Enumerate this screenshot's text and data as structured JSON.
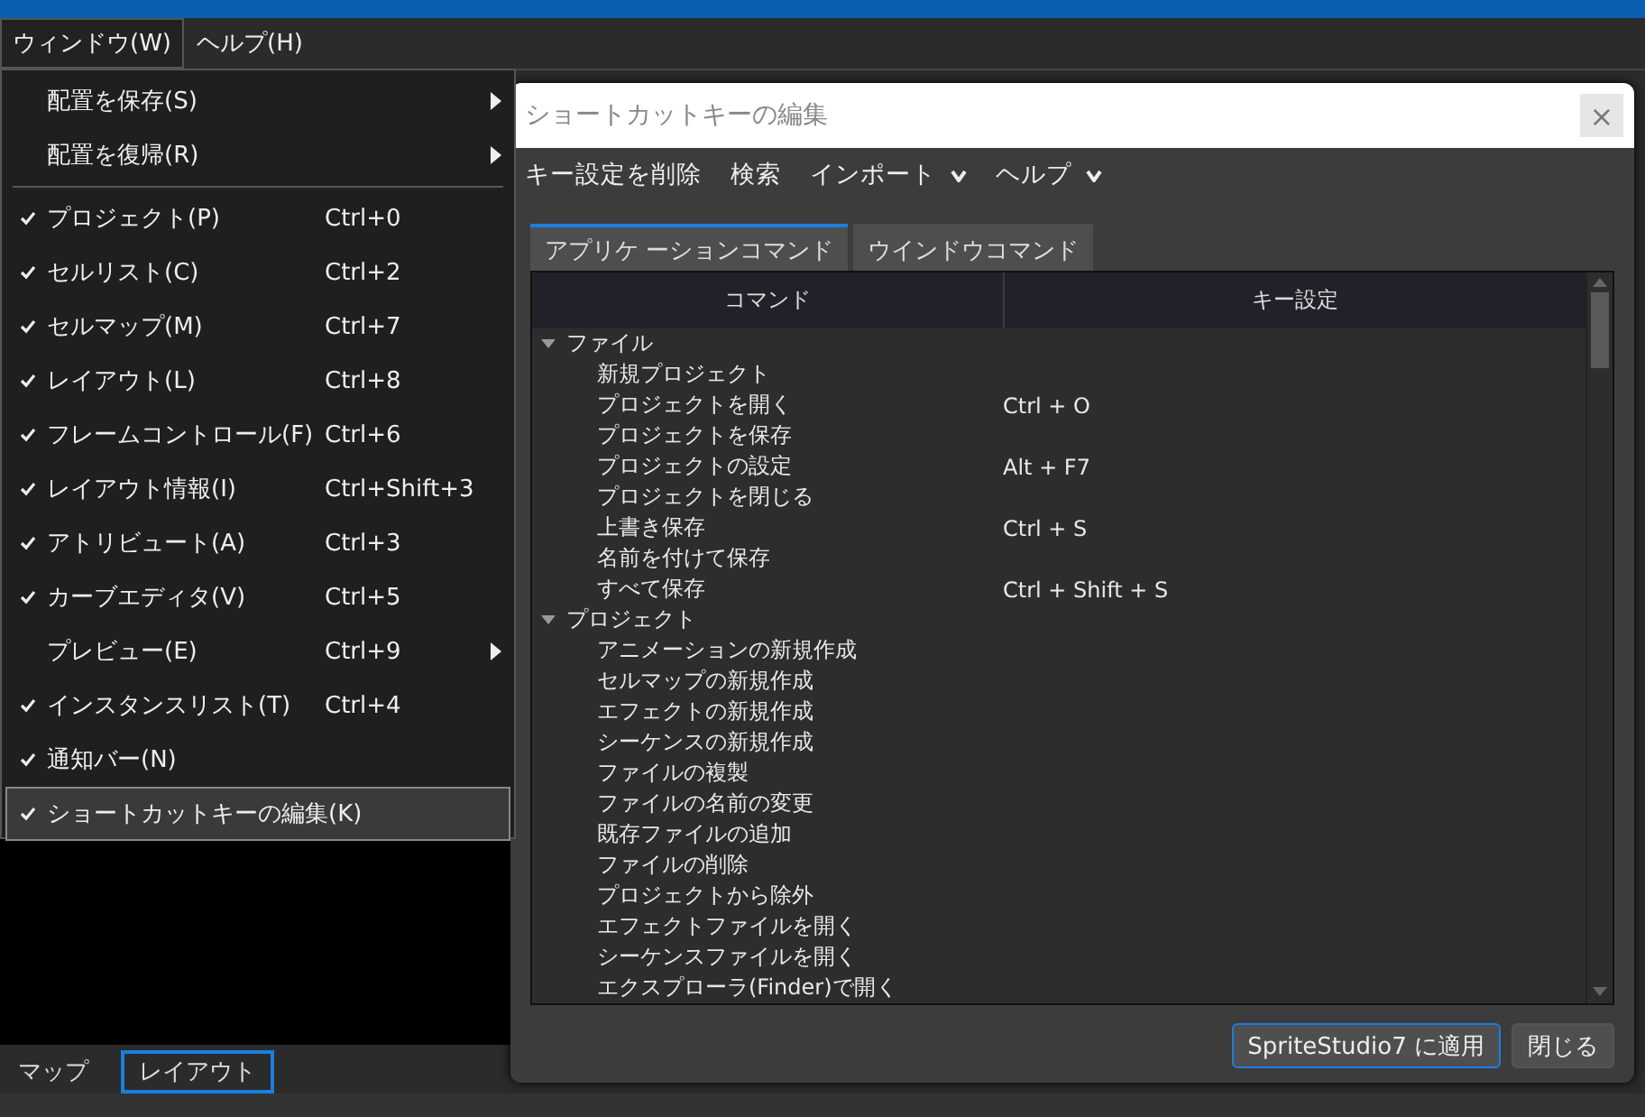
{
  "menubar": [
    {
      "label": "ウィンドウ(W)",
      "selected": true
    },
    {
      "label": "ヘルプ(H)",
      "selected": false
    }
  ],
  "dropdown": [
    {
      "kind": "item",
      "label": "配置を保存(S)",
      "checked": false,
      "submenu": true,
      "selected": false
    },
    {
      "kind": "item",
      "label": "配置を復帰(R)",
      "checked": false,
      "submenu": true,
      "selected": false
    },
    {
      "kind": "separator"
    },
    {
      "kind": "item",
      "label": "プロジェクト(P)",
      "shortcut": "Ctrl+0",
      "checked": true,
      "submenu": false,
      "selected": false
    },
    {
      "kind": "item",
      "label": "セルリスト(C)",
      "shortcut": "Ctrl+2",
      "checked": true,
      "submenu": false,
      "selected": false
    },
    {
      "kind": "item",
      "label": "セルマップ(M)",
      "shortcut": "Ctrl+7",
      "checked": true,
      "submenu": false,
      "selected": false
    },
    {
      "kind": "item",
      "label": "レイアウト(L)",
      "shortcut": "Ctrl+8",
      "checked": true,
      "submenu": false,
      "selected": false
    },
    {
      "kind": "item",
      "label": "フレームコントロール(F)",
      "shortcut": "Ctrl+6",
      "checked": true,
      "submenu": false,
      "selected": false
    },
    {
      "kind": "item",
      "label": "レイアウト情報(I)",
      "shortcut": "Ctrl+Shift+3",
      "checked": true,
      "submenu": false,
      "selected": false
    },
    {
      "kind": "item",
      "label": "アトリビュート(A)",
      "shortcut": "Ctrl+3",
      "checked": true,
      "submenu": false,
      "selected": false
    },
    {
      "kind": "item",
      "label": "カーブエディタ(V)",
      "shortcut": "Ctrl+5",
      "checked": true,
      "submenu": false,
      "selected": false
    },
    {
      "kind": "item",
      "label": "プレビュー(E)",
      "shortcut": "Ctrl+9",
      "checked": false,
      "submenu": true,
      "selected": false
    },
    {
      "kind": "item",
      "label": "インスタンスリスト(T)",
      "shortcut": "Ctrl+4",
      "checked": true,
      "submenu": false,
      "selected": false
    },
    {
      "kind": "item",
      "label": "通知バー(N)",
      "checked": true,
      "submenu": false,
      "selected": false
    },
    {
      "kind": "item",
      "label": "ショートカットキーの編集(K)",
      "checked": true,
      "submenu": false,
      "selected": true
    }
  ],
  "bottom_tabs": [
    {
      "label": "マップ",
      "selected": false
    },
    {
      "label": "レイアウト",
      "selected": true
    }
  ],
  "dialog": {
    "title": "ショートカットキーの編集",
    "close": "×",
    "toolbar": [
      {
        "label": "キー設定を削除",
        "dropdown": false
      },
      {
        "label": "検索",
        "dropdown": false
      },
      {
        "label": "インポート",
        "dropdown": true
      },
      {
        "label": "ヘルプ",
        "dropdown": true
      }
    ],
    "tabs": [
      {
        "label": "アプリケ ーションコマンド",
        "selected": true
      },
      {
        "label": "ウインドウコマンド",
        "selected": false
      }
    ],
    "columns": [
      "コマンド",
      "キー設定"
    ],
    "tree": [
      {
        "label": "ファイル",
        "expanded": true,
        "children": [
          {
            "command": "新規プロジェクト"
          },
          {
            "command": "プロジェクトを開く",
            "key": "Ctrl + O"
          },
          {
            "command": "プロジェクトを保存"
          },
          {
            "command": "プロジェクトの設定",
            "key": "Alt + F7"
          },
          {
            "command": "プロジェクトを閉じる"
          },
          {
            "command": "上書き保存",
            "key": "Ctrl + S"
          },
          {
            "command": "名前を付けて保存"
          },
          {
            "command": "すべて保存",
            "key": "Ctrl + Shift + S"
          }
        ]
      },
      {
        "label": "プロジェクト",
        "expanded": true,
        "children": [
          {
            "command": "アニメーションの新規作成"
          },
          {
            "command": "セルマップの新規作成"
          },
          {
            "command": "エフェクトの新規作成"
          },
          {
            "command": "シーケンスの新規作成"
          },
          {
            "command": "ファイルの複製"
          },
          {
            "command": "ファイルの名前の変更"
          },
          {
            "command": "既存ファイルの追加"
          },
          {
            "command": "ファイルの削除"
          },
          {
            "command": "プロジェクトから除外"
          },
          {
            "command": "エフェクトファイルを開く"
          },
          {
            "command": "シーケンスファイルを開く"
          },
          {
            "command": "エクスプローラ(Finder)で開く"
          }
        ]
      }
    ],
    "buttons": [
      {
        "label": "SpriteStudio7 に適用",
        "selected": true
      },
      {
        "label": "閉じる",
        "selected": false
      }
    ]
  }
}
